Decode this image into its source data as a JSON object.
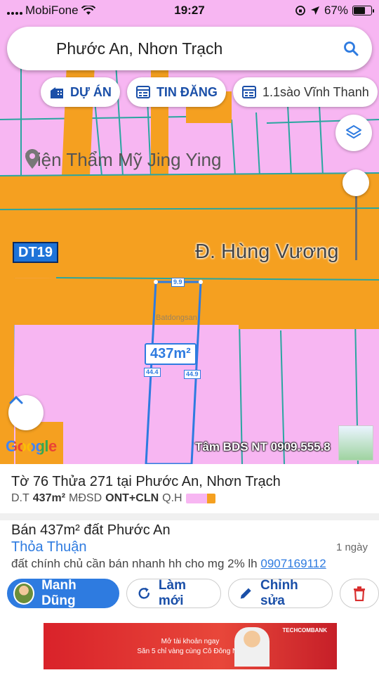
{
  "status_bar": {
    "carrier": "MobiFone",
    "time": "19:27",
    "battery": "67%",
    "battery_level": 0.67
  },
  "search": {
    "query": "Phước An, Nhơn Trạch"
  },
  "chips": [
    {
      "label": "DỰ ÁN",
      "icon": "office-building-icon"
    },
    {
      "label": "TIN ĐĂNG",
      "icon": "calendar-grid-icon"
    },
    {
      "label": "1.1sào Vĩnh Thanh",
      "icon": "calendar-grid-icon"
    }
  ],
  "map": {
    "poi_label": "Viện Thẩm Mỹ Jing Ying",
    "road_badge": "DT19",
    "street_name": "Đ. Hùng Vương",
    "parcel_area": "437m²",
    "dim_top": "9.9",
    "dim_left": "44.4",
    "dim_right": "44.9",
    "watermark": "Batdongsan",
    "google_logo": "Google",
    "overlay_label": "Tâm BDS NT 0909.555.8",
    "colors": {
      "land": "#f7b6f2",
      "road": "#f5a020",
      "parcel_outline": "#2e7be0"
    }
  },
  "panel": {
    "parcel_title": "Tờ 76 Thửa 271 tại Phước An, Nhơn Trạch",
    "dt_label": "D.T",
    "area_value": "437m²",
    "mdsd_label": "MĐSD",
    "land_use": "ONT+CLN",
    "qh_label": "Q.H",
    "listing_title": "Bán 437m² đất Phước An",
    "price": "Thỏa Thuận",
    "age": "1 ngày",
    "description": "đất chính chủ cần bán nhanh hh cho mg 2% lh",
    "phone": "0907169112"
  },
  "actions": [
    {
      "label": "Manh Dũng"
    },
    {
      "label": "Làm mới"
    },
    {
      "label": "Chỉnh sửa"
    }
  ],
  "ad": {
    "line1": "Mở tài khoản ngay",
    "line2": "Săn 5 chỉ vàng cùng Cô Đông Nát",
    "bank": "TECHCOMBANK"
  }
}
